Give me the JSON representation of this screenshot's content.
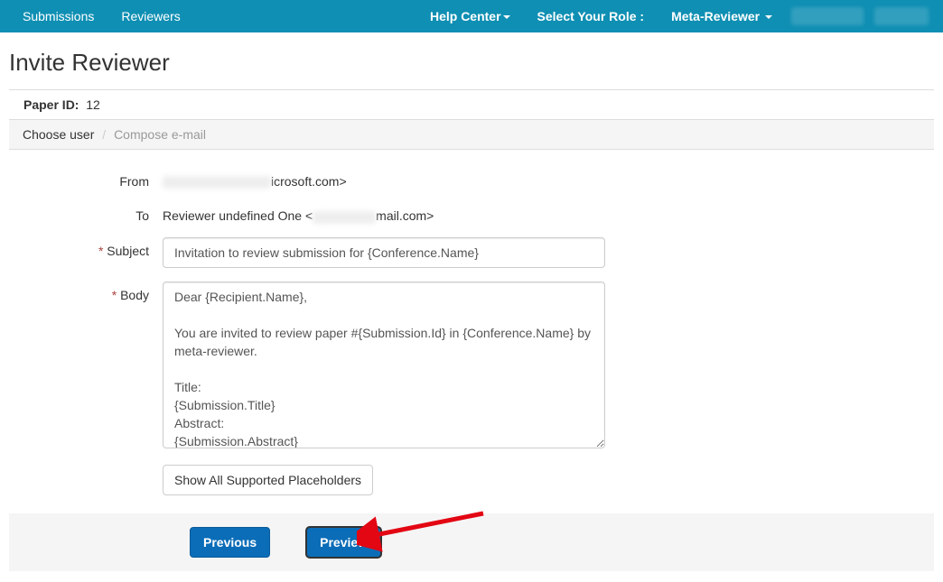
{
  "nav": {
    "submissions": "Submissions",
    "reviewers": "Reviewers",
    "help_center": "Help Center",
    "select_role": "Select Your Role :",
    "role_value": "Meta-Reviewer"
  },
  "page": {
    "title": "Invite Reviewer",
    "paper_id_label": "Paper ID:",
    "paper_id": "12"
  },
  "breadcrumb": {
    "step1": "Choose user",
    "step2": "Compose e-mail"
  },
  "form": {
    "from_label": "From",
    "from_value_suffix": "icrosoft.com>",
    "to_label": "To",
    "to_value_prefix": "Reviewer undefined One <",
    "to_value_suffix": "mail.com>",
    "subject_label": "Subject",
    "subject_value": "Invitation to review submission for {Conference.Name}",
    "body_label": "Body",
    "body_value": "Dear {Recipient.Name},\n\nYou are invited to review paper #{Submission.Id} in {Conference.Name} by meta-reviewer.\n\nTitle:\n{Submission.Title}\nAbstract:\n{Submission.Abstract}\n\nClick the link below to accept or decline the invitation."
  },
  "buttons": {
    "show_placeholders": "Show All Supported Placeholders",
    "previous": "Previous",
    "preview": "Preview"
  }
}
